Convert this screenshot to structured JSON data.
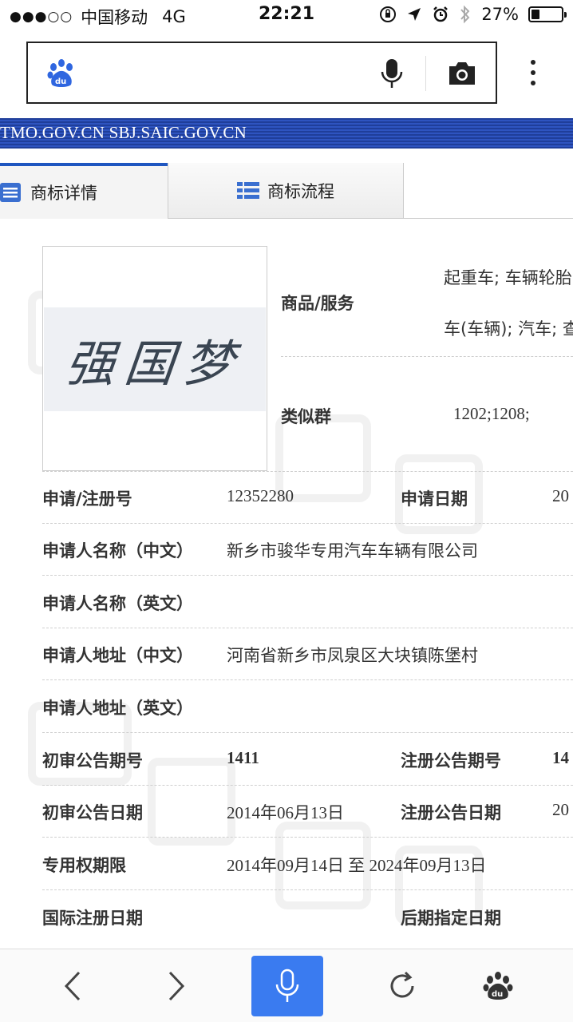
{
  "status_bar": {
    "signal": "●●●○○",
    "carrier": "中国移动",
    "network": "4G",
    "time": "22:21",
    "battery_percent": "27%",
    "battery_level": 0.27
  },
  "banner": {
    "text": "TMO.GOV.CN SBJ.SAIC.GOV.CN"
  },
  "tabs": [
    {
      "label": "商标详情",
      "active": true
    },
    {
      "label": "商标流程",
      "active": false
    }
  ],
  "trademark": {
    "logo_text": "强国梦",
    "goods_label": "商品/服务",
    "goods_line1": "起重车; 车辆轮胎",
    "goods_line2": "车(车辆); 汽车; 查",
    "similar_group_label": "类似群",
    "similar_group_value": "1202;1208;"
  },
  "fields": {
    "reg_no_label": "申请/注册号",
    "reg_no_value": "12352280",
    "app_date_label": "申请日期",
    "app_date_value": "20",
    "applicant_cn_label": "申请人名称（中文）",
    "applicant_cn_value": "新乡市骏华专用汽车车辆有限公司",
    "applicant_en_label": "申请人名称（英文）",
    "address_cn_label": "申请人地址（中文）",
    "address_cn_value": "河南省新乡市凤泉区大块镇陈堡村",
    "address_en_label": "申请人地址（英文）",
    "prelim_issue_label": "初审公告期号",
    "prelim_issue_value": "1411",
    "reg_issue_label": "注册公告期号",
    "reg_issue_value": "14",
    "prelim_date_label": "初审公告日期",
    "prelim_date_value": "2014年06月13日",
    "reg_date_label": "注册公告日期",
    "reg_date_value": "20",
    "term_label": "专用权期限",
    "term_value": "2014年09月14日 至 2024年09月13日",
    "intl_date_label": "国际注册日期",
    "later_date_label": "后期指定日期"
  },
  "colors": {
    "accent": "#3a7bf0",
    "banner": "#1f3e9a",
    "link": "#2a5cc4"
  }
}
